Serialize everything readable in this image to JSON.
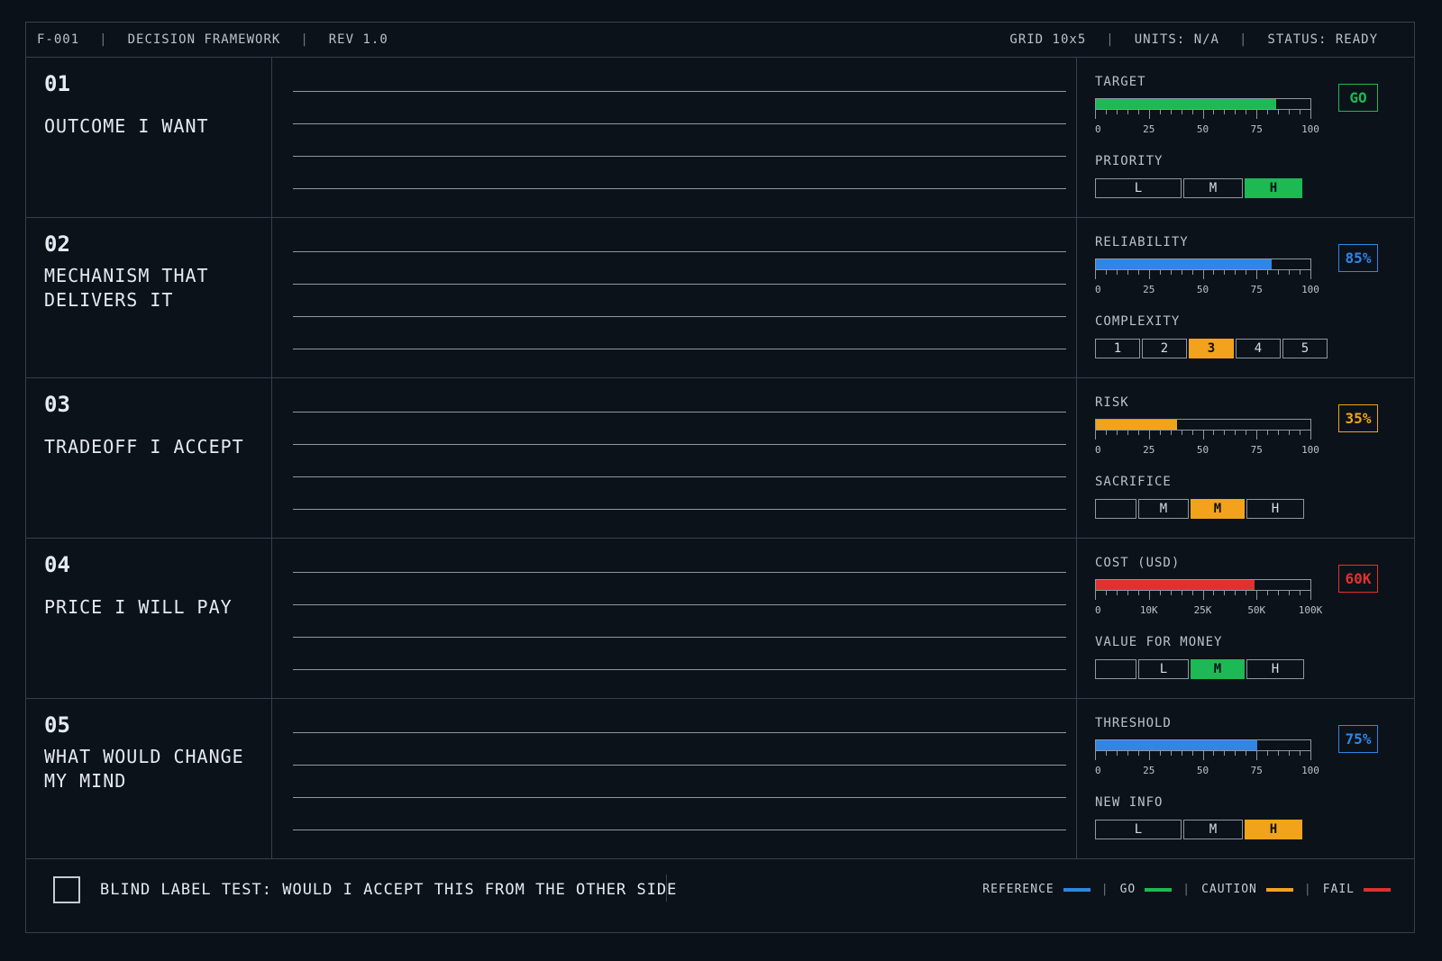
{
  "header": {
    "id": "F-001",
    "title": "DECISION FRAMEWORK",
    "rev": "REV 1.0",
    "grid": "GRID 10x5",
    "units": "UNITS: N/A",
    "status": "STATUS: READY"
  },
  "colors": {
    "reference": "#2f86e6",
    "go": "#1db954",
    "caution": "#f2a31b",
    "fail": "#e0312f"
  },
  "rows": [
    {
      "num": "01",
      "title": "OUTCOME I WANT",
      "metric_label": "TARGET",
      "value": 84,
      "max": 100,
      "color": "go",
      "ticks": [
        "0",
        "25",
        "50",
        "75",
        "100"
      ],
      "badge": "GO",
      "sub_label": "PRIORITY",
      "segments": [
        "L",
        "M",
        "H"
      ],
      "active_segment": "H"
    },
    {
      "num": "02",
      "title": "MECHANISM THAT DELIVERS IT",
      "metric_label": "RELIABILITY",
      "value": 82,
      "max": 100,
      "color": "reference",
      "ticks": [
        "0",
        "25",
        "50",
        "75",
        "100"
      ],
      "badge": "85%",
      "sub_label": "COMPLEXITY",
      "segments": [
        "1",
        "2",
        "3",
        "4",
        "5"
      ],
      "active_segment": "3"
    },
    {
      "num": "03",
      "title": "TRADEOFF I ACCEPT",
      "metric_label": "RISK",
      "value": 38,
      "max": 100,
      "color": "caution",
      "ticks": [
        "0",
        "25",
        "50",
        "75",
        "100"
      ],
      "badge": "35%",
      "sub_label": "SACRIFICE",
      "segments": [
        "",
        "M",
        "M",
        "H"
      ],
      "active_segment_index": 2
    },
    {
      "num": "04",
      "title": "PRICE I WILL PAY",
      "metric_label": "COST (USD)",
      "value": 74,
      "max": 100,
      "color": "fail",
      "ticks": [
        "0",
        "10K",
        "25K",
        "50K",
        "100K"
      ],
      "badge": "60K",
      "sub_label": "VALUE FOR MONEY",
      "segments": [
        "",
        "L",
        "M",
        "H"
      ],
      "active_segment_index": 2
    },
    {
      "num": "05",
      "title": "WHAT WOULD CHANGE MY MIND",
      "metric_label": "THRESHOLD",
      "value": 75,
      "max": 100,
      "color": "reference",
      "ticks": [
        "0",
        "25",
        "50",
        "75",
        "100"
      ],
      "badge": "75%",
      "sub_label": "NEW INFO",
      "segments": [
        "L",
        "M",
        "H"
      ],
      "active_segment": "H"
    }
  ],
  "footer": {
    "blind_label": "BLIND LABEL TEST:  WOULD I ACCEPT THIS FROM THE OTHER SIDE",
    "legend": [
      {
        "label": "REFERENCE",
        "color": "reference"
      },
      {
        "label": "GO",
        "color": "go"
      },
      {
        "label": "CAUTION",
        "color": "caution"
      },
      {
        "label": "FAIL",
        "color": "fail"
      }
    ]
  }
}
